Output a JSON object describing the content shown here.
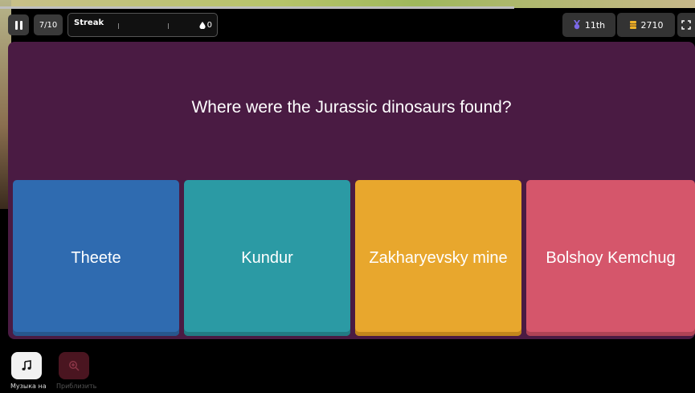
{
  "topbar": {
    "counter": "7/10",
    "streak_label": "Streak",
    "streak_count": "0",
    "rank": "11th",
    "coins": "2710"
  },
  "question": {
    "text": "Where were the Jurassic dinosaurs found?"
  },
  "answers": [
    {
      "label": "Theete",
      "color": "#2f6bb0"
    },
    {
      "label": "Kundur",
      "color": "#2b9aa4"
    },
    {
      "label": "Zakharyevsky mine",
      "color": "#e8a72d"
    },
    {
      "label": "Bolshoy Kemchug",
      "color": "#d5566b"
    }
  ],
  "bottom": {
    "music_label": "Музыка на",
    "zoom_label": "Приблизить"
  },
  "icons": {
    "pause": "pause-icon",
    "streak": "drop-icon",
    "rank": "medal-icon",
    "coins": "coin-stack-icon",
    "fullscreen": "fullscreen-icon",
    "music": "music-note-icon",
    "zoom": "zoom-in-icon"
  },
  "colors": {
    "panel": "#4a1b43",
    "background": "#000000"
  }
}
